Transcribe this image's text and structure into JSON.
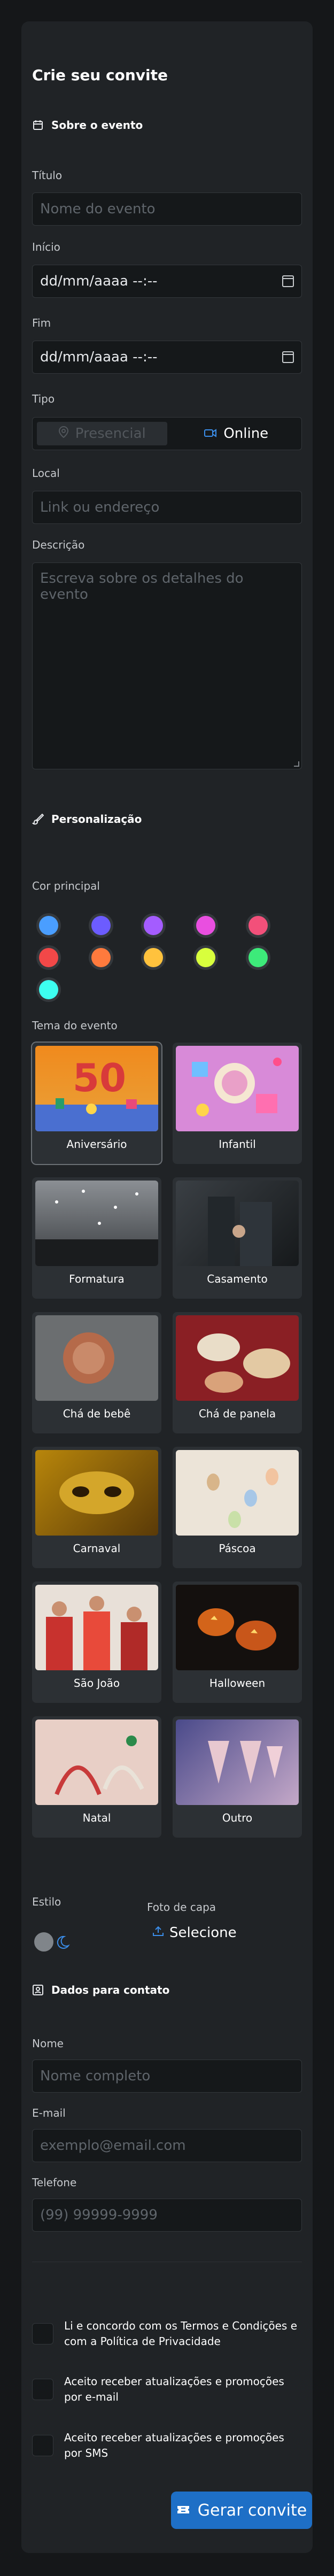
{
  "form": {
    "title": "Crie seu convite",
    "about_section": {
      "heading": "Sobre o evento",
      "icon": "calendar-icon",
      "title_label": "Título",
      "title_placeholder": "Nome do evento",
      "start_label": "Início",
      "start_value": "dd/mm/aaaa --:--",
      "end_label": "Fim",
      "end_value": "dd/mm/aaaa --:--",
      "type_label": "Tipo",
      "type_options": [
        "Presencial",
        "Online"
      ],
      "type_selected": "Online",
      "location_label": "Local",
      "location_placeholder": "Link ou endereço",
      "description_label": "Descrição",
      "description_placeholder": "Escreva sobre os detalhes do evento"
    },
    "personalization": {
      "heading": "Personalização",
      "icon": "brush-icon",
      "color_label": "Cor principal",
      "colors": [
        "#4a9eff",
        "#6c5cff",
        "#a45cff",
        "#e94fe0",
        "#f2507a",
        "#f24848",
        "#ff7a3d",
        "#ffc23d",
        "#d8ff3d",
        "#3dea7a",
        "#3dfff0"
      ],
      "theme_label": "Tema do evento",
      "themes": [
        "Aniversário",
        "Infantil",
        "Formatura",
        "Casamento",
        "Chá de bebê",
        "Chá de panela",
        "Carnaval",
        "Páscoa",
        "São João",
        "Halloween",
        "Natal",
        "Outro"
      ],
      "style_label": "Estilo",
      "cover_label": "Foto de capa",
      "cover_button": "Selecione"
    },
    "contact_section": {
      "heading": "Dados para contato",
      "icon": "contact-card-icon",
      "name_label": "Nome",
      "name_placeholder": "Nome completo",
      "email_label": "E-mail",
      "email_placeholder": "exemplo@email.com",
      "phone_label": "Telefone",
      "phone_placeholder": "(99) 99999-9999"
    },
    "consents": [
      "Li e concordo com os Termos e Condições e com a Política de Privacidade",
      "Aceito receber atualizações e promoções por e-mail",
      "Aceito receber atualizações e promoções por SMS"
    ],
    "submit_label": "Gerar convite",
    "submit_icon": "ticket-icon"
  }
}
